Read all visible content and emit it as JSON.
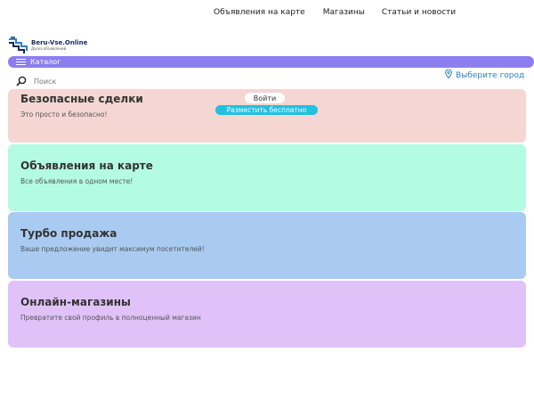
{
  "topnav": {
    "items": [
      {
        "label": "Объявления на карте"
      },
      {
        "label": "Магазины"
      },
      {
        "label": "Статьи и новости"
      }
    ]
  },
  "logo": {
    "title": "Beru-Vse.Online",
    "subtitle": "Доска объявлений",
    "icon": "logo-stairs-icon"
  },
  "catalog": {
    "label": "Каталог",
    "icon": "menu-list-icon",
    "color": "#8c7ef0"
  },
  "search": {
    "placeholder": "Поиск",
    "icon": "search-icon"
  },
  "city": {
    "label": "Выберите город",
    "icon": "location-pin-icon",
    "color": "#2f7fc4"
  },
  "auth": {
    "login_label": "Войти",
    "post_label": "Разместить бесплатно",
    "post_color": "#23c0e0"
  },
  "cards": [
    {
      "title": "Безопасные сделки",
      "text": "Это просто и безопасно!",
      "color": "#f5d6d2"
    },
    {
      "title": "Объявления на карте",
      "text": "Все объявления в одном месте!",
      "color": "#b3fbe3"
    },
    {
      "title": "Турбо продажа",
      "text": "Ваше предложение увидит максимум посетителей!",
      "color": "#a9cbf1"
    },
    {
      "title": "Онлайн-магазины",
      "text": "Превратите свой профиль в полноценный магазин",
      "color": "#e0c2f9"
    }
  ]
}
